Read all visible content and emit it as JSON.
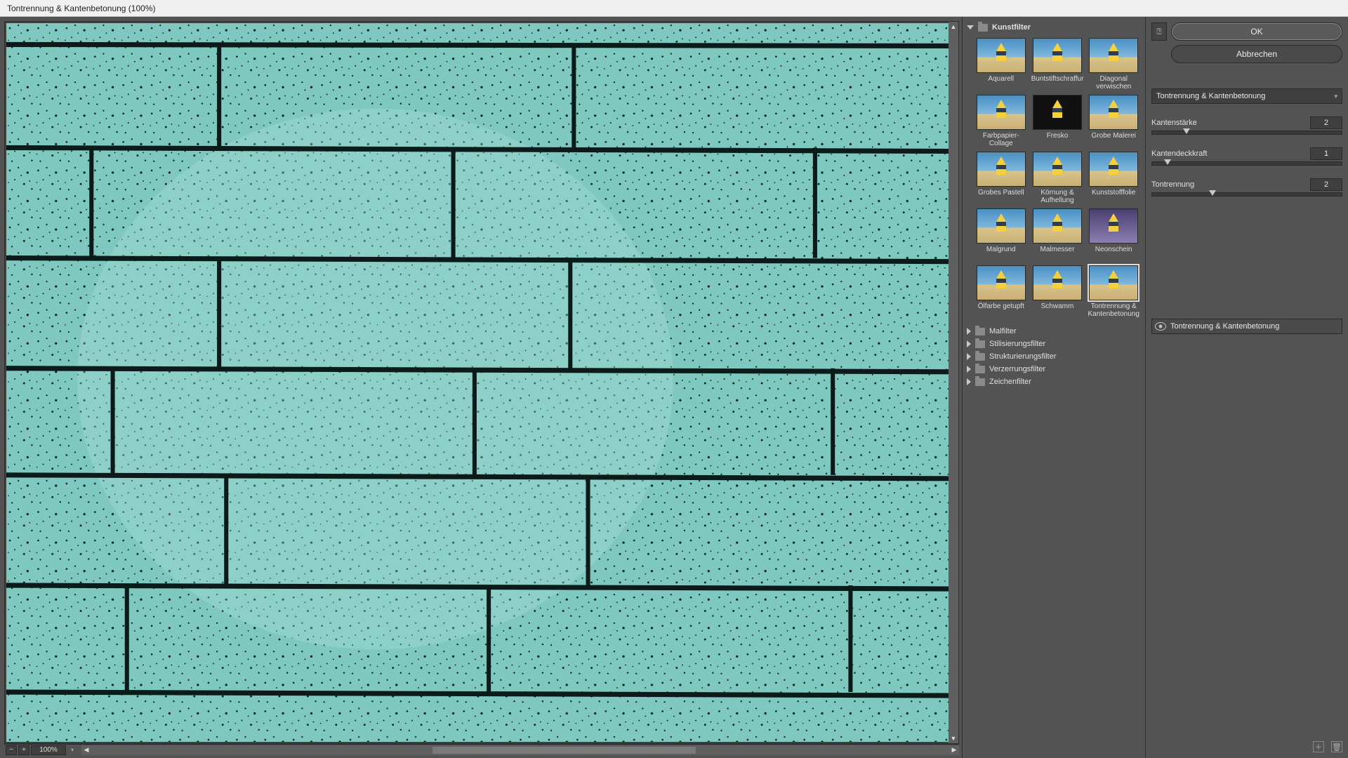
{
  "window": {
    "title": "Tontrennung & Kantenbetonung (100%)"
  },
  "zoom": {
    "value": "100%"
  },
  "buttons": {
    "ok": "OK",
    "cancel": "Abbrechen"
  },
  "filterSelect": {
    "value": "Tontrennung & Kantenbetonung"
  },
  "params": {
    "edgeThickness": {
      "label": "Kantenstärke",
      "value": "2",
      "sliderPct": 18
    },
    "edgeIntensity": {
      "label": "Kantendeckkraft",
      "value": "1",
      "sliderPct": 8
    },
    "posterization": {
      "label": "Tontrennung",
      "value": "2",
      "sliderPct": 32
    }
  },
  "categories": {
    "kunstfilter": {
      "label": "Kunstfilter",
      "open": true,
      "items": [
        {
          "label": "Aquarell"
        },
        {
          "label": "Buntstiftschraffur"
        },
        {
          "label": "Diagonal verwischen"
        },
        {
          "label": "Farbpapier-Collage"
        },
        {
          "label": "Fresko"
        },
        {
          "label": "Grobe Malerei"
        },
        {
          "label": "Grobes Pastell"
        },
        {
          "label": "Körnung & Aufhellung"
        },
        {
          "label": "Kunststofffolie"
        },
        {
          "label": "Malgrund"
        },
        {
          "label": "Malmesser"
        },
        {
          "label": "Neonschein"
        },
        {
          "label": "Ölfarbe getupft"
        },
        {
          "label": "Schwamm"
        },
        {
          "label": "Tontrennung & Kantenbetonung",
          "selected": true
        }
      ]
    },
    "malfilter": {
      "label": "Malfilter"
    },
    "stilisierung": {
      "label": "Stilisierungsfilter"
    },
    "strukturierung": {
      "label": "Strukturierungsfilter"
    },
    "verzerrung": {
      "label": "Verzerrungsfilter"
    },
    "zeichen": {
      "label": "Zeichenfilter"
    }
  },
  "layers": {
    "current": "Tontrennung & Kantenbetonung"
  },
  "icons": {
    "toggle_thumbs": "toggle-thumbnails-icon",
    "chevron_down": "chevron-down-icon",
    "eye": "eye-icon",
    "new_layer": "new-effect-layer-icon",
    "trash": "trash-icon",
    "arrow_up": "scroll-up-icon",
    "arrow_down": "scroll-down-icon",
    "arrow_left": "scroll-left-icon",
    "arrow_right": "scroll-right-icon",
    "zoom_out": "zoom-out-icon",
    "zoom_in": "zoom-in-icon"
  }
}
